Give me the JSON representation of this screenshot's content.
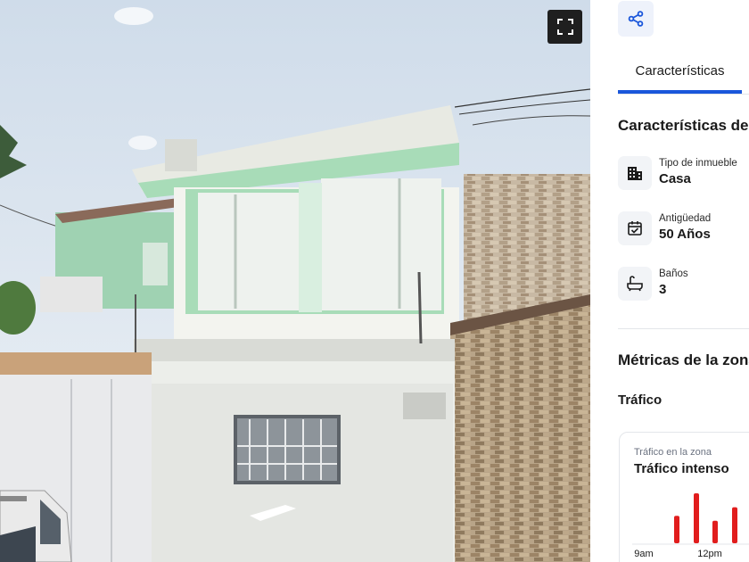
{
  "photo": {
    "alt_icon": "fullscreen-icon"
  },
  "panel": {
    "share_icon": "share-icon",
    "tab_label": "Características",
    "section_title": "Características de",
    "features": [
      {
        "icon": "building-icon",
        "label": "Tipo de inmueble",
        "value": "Casa"
      },
      {
        "icon": "calendar-check-icon",
        "label": "Antigüedad",
        "value": "50 Años"
      },
      {
        "icon": "bathtub-icon",
        "label": "Baños",
        "value": "3"
      }
    ],
    "metrics_title": "Métricas de la zona",
    "traffic_title": "Tráfico",
    "traffic_card": {
      "subtitle": "Tráfico en la zona",
      "level": "Tráfico intenso"
    }
  },
  "chart_data": {
    "type": "bar",
    "ticks": [
      "9am",
      "12pm"
    ],
    "bar_color": "#e11d1d",
    "relative_values": [
      0.55,
      1.0,
      0.45,
      0.72
    ]
  },
  "colors": {
    "accent": "#1a56db",
    "traffic_bar": "#e11d1d"
  }
}
